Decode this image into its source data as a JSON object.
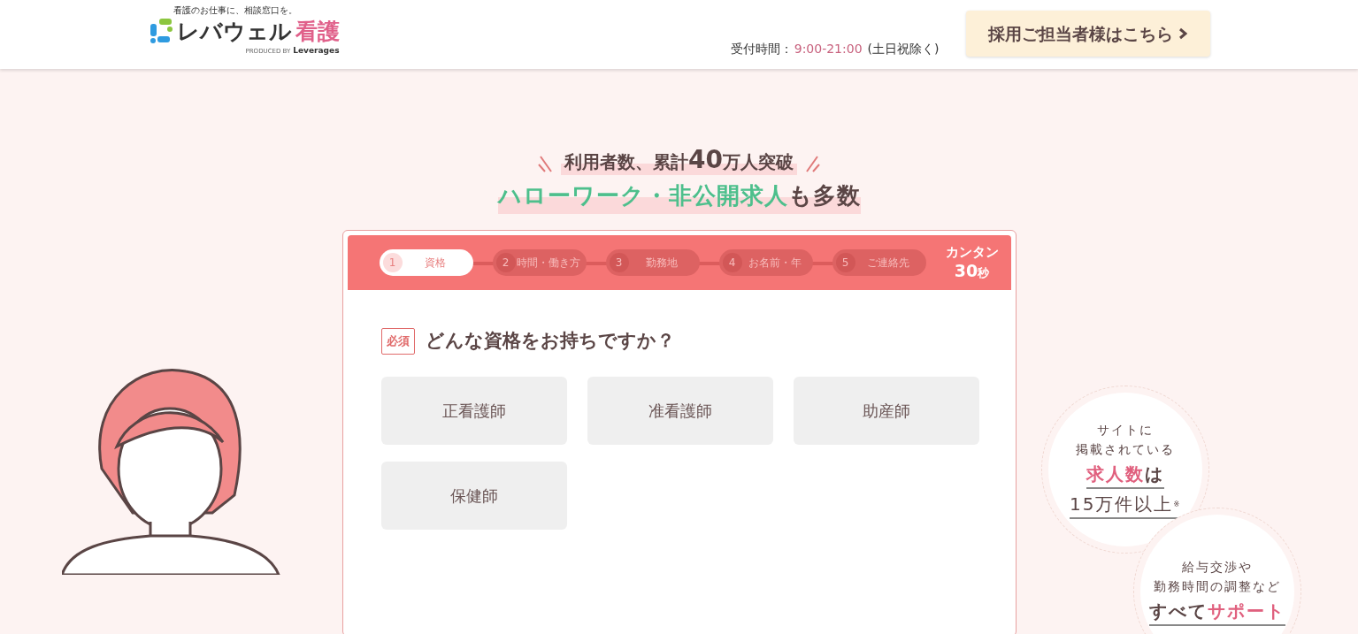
{
  "header": {
    "tagline": "看護のお仕事に、相談窓口を。",
    "logo_text": "レバウェル",
    "logo_accent": "看護",
    "logo_sub_prefix": "PRODUCED BY",
    "logo_sub_brand": "Leverages",
    "hours_label": "受付時間：",
    "hours_time": "9:00-21:00",
    "hours_note": "(土日祝除く)",
    "employer_button": "採用ご担当者様はこちら"
  },
  "headline": {
    "line1_before": "利用者数、累計",
    "line1_number": "40",
    "line1_after": "万人突破",
    "line2_highlight": "ハローワーク・非公開求人",
    "line2_rest": "も多数"
  },
  "form": {
    "steps": [
      {
        "number": "1",
        "label": "資格",
        "selected": true
      },
      {
        "number": "2",
        "label": "時間・働き方",
        "selected": false
      },
      {
        "number": "3",
        "label": "勤務地",
        "selected": false
      },
      {
        "number": "4",
        "label": "お名前・年",
        "selected": false
      },
      {
        "number": "5",
        "label": "ご連絡先",
        "selected": false
      }
    ],
    "duration_label": "カンタン",
    "duration_number": "30",
    "duration_unit": "秒",
    "required_badge": "必須",
    "question": "どんな資格をお持ちですか？",
    "options": [
      "正看護師",
      "准看護師",
      "助産師",
      "保健師"
    ]
  },
  "badges": [
    {
      "lines": [
        "サイトに",
        "掲載されている"
      ],
      "accent": "求人数",
      "accent_after": "は",
      "last": "15万件以上",
      "note": "※"
    },
    {
      "lines": [
        "給与交渉や",
        "勤務時間の調整など"
      ],
      "accent_before": "すべて",
      "accent": "サポート"
    }
  ]
}
